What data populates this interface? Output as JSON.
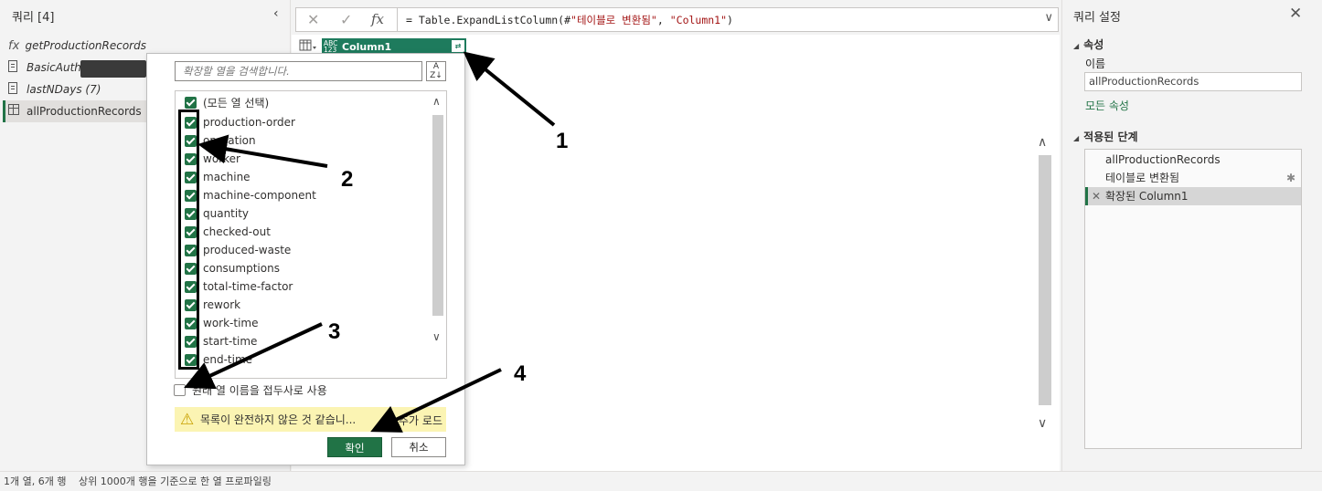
{
  "queries_pane": {
    "title": "쿼리 [4]",
    "items": [
      {
        "label": "getProductionRecords",
        "icon": "fx-icon"
      },
      {
        "label": "BasicAuth",
        "icon": "parameter-icon"
      },
      {
        "label": "lastNDays (7)",
        "icon": "parameter-icon"
      },
      {
        "label": "allProductionRecords",
        "icon": "table-icon",
        "selected": true
      }
    ]
  },
  "formula_bar": {
    "prefix": "= Table.ExpandListColumn(#",
    "str1": "\"테이블로 변환됨\"",
    "mid": ", ",
    "str2": "\"Column1\"",
    "suffix": ")"
  },
  "column": {
    "type_label_top": "ABC",
    "type_label_bottom": "123",
    "name": "Column1"
  },
  "popup": {
    "search_placeholder": "확장할 열을 검색합니다.",
    "select_all": "(모든 열 선택)",
    "columns": [
      "production-order",
      "operation",
      "worker",
      "machine",
      "machine-component",
      "quantity",
      "checked-out",
      "produced-waste",
      "consumptions",
      "total-time-factor",
      "rework",
      "work-time",
      "start-time",
      "end-time"
    ],
    "prefix_option": "원래 열 이름을 접두사로 사용",
    "warning_text": "목록이 완전하지 않은 것 같습니...",
    "load_more": "추가 로드",
    "ok_label": "확인",
    "cancel_label": "취소"
  },
  "settings_pane": {
    "title": "쿼리 설정",
    "properties_header": "속성",
    "name_label": "이름",
    "name_value": "allProductionRecords",
    "all_properties_link": "모든 속성",
    "applied_steps_header": "적용된 단계",
    "steps": [
      "allProductionRecords",
      "테이블로 변환됨",
      "확장된 Column1"
    ]
  },
  "status_bar": {
    "left": "1개 열, 6개 행",
    "right": "상위 1000개 행을 기준으로 한 열 프로파일링"
  },
  "annotations": [
    "1",
    "2",
    "3",
    "4"
  ],
  "colors": {
    "accent": "#217346",
    "header": "#1e7b5d",
    "warning_bg": "#fbf4b3"
  }
}
